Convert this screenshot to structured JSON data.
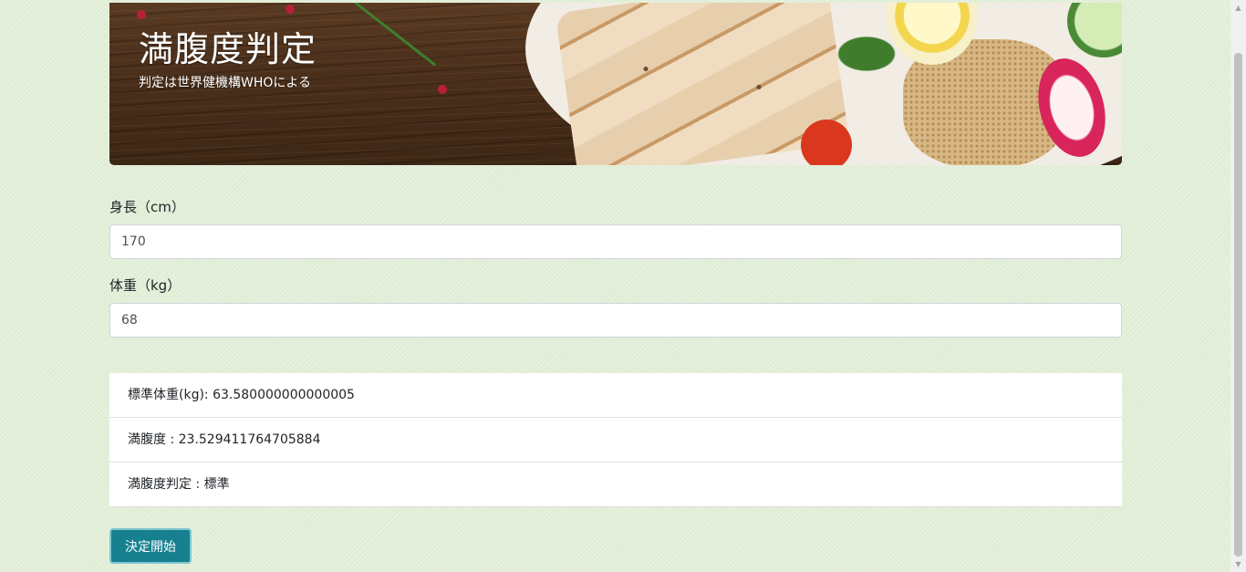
{
  "banner": {
    "title": "満腹度判定",
    "subtitle": "判定は世界健機構WHOによる"
  },
  "form": {
    "height": {
      "label": "身長（cm）",
      "value": "170"
    },
    "weight": {
      "label": "体重（kg）",
      "value": "68"
    }
  },
  "results": [
    {
      "text": "標準体重(kg): 63.580000000000005"
    },
    {
      "text": "満腹度 : 23.529411764705884"
    },
    {
      "text": "満腹度判定 : 標準"
    }
  ],
  "actions": {
    "submit_label": "決定開始"
  },
  "colors": {
    "page_background": "#e3efd9",
    "button_background": "#17808f",
    "button_border": "#7fc6cf"
  }
}
